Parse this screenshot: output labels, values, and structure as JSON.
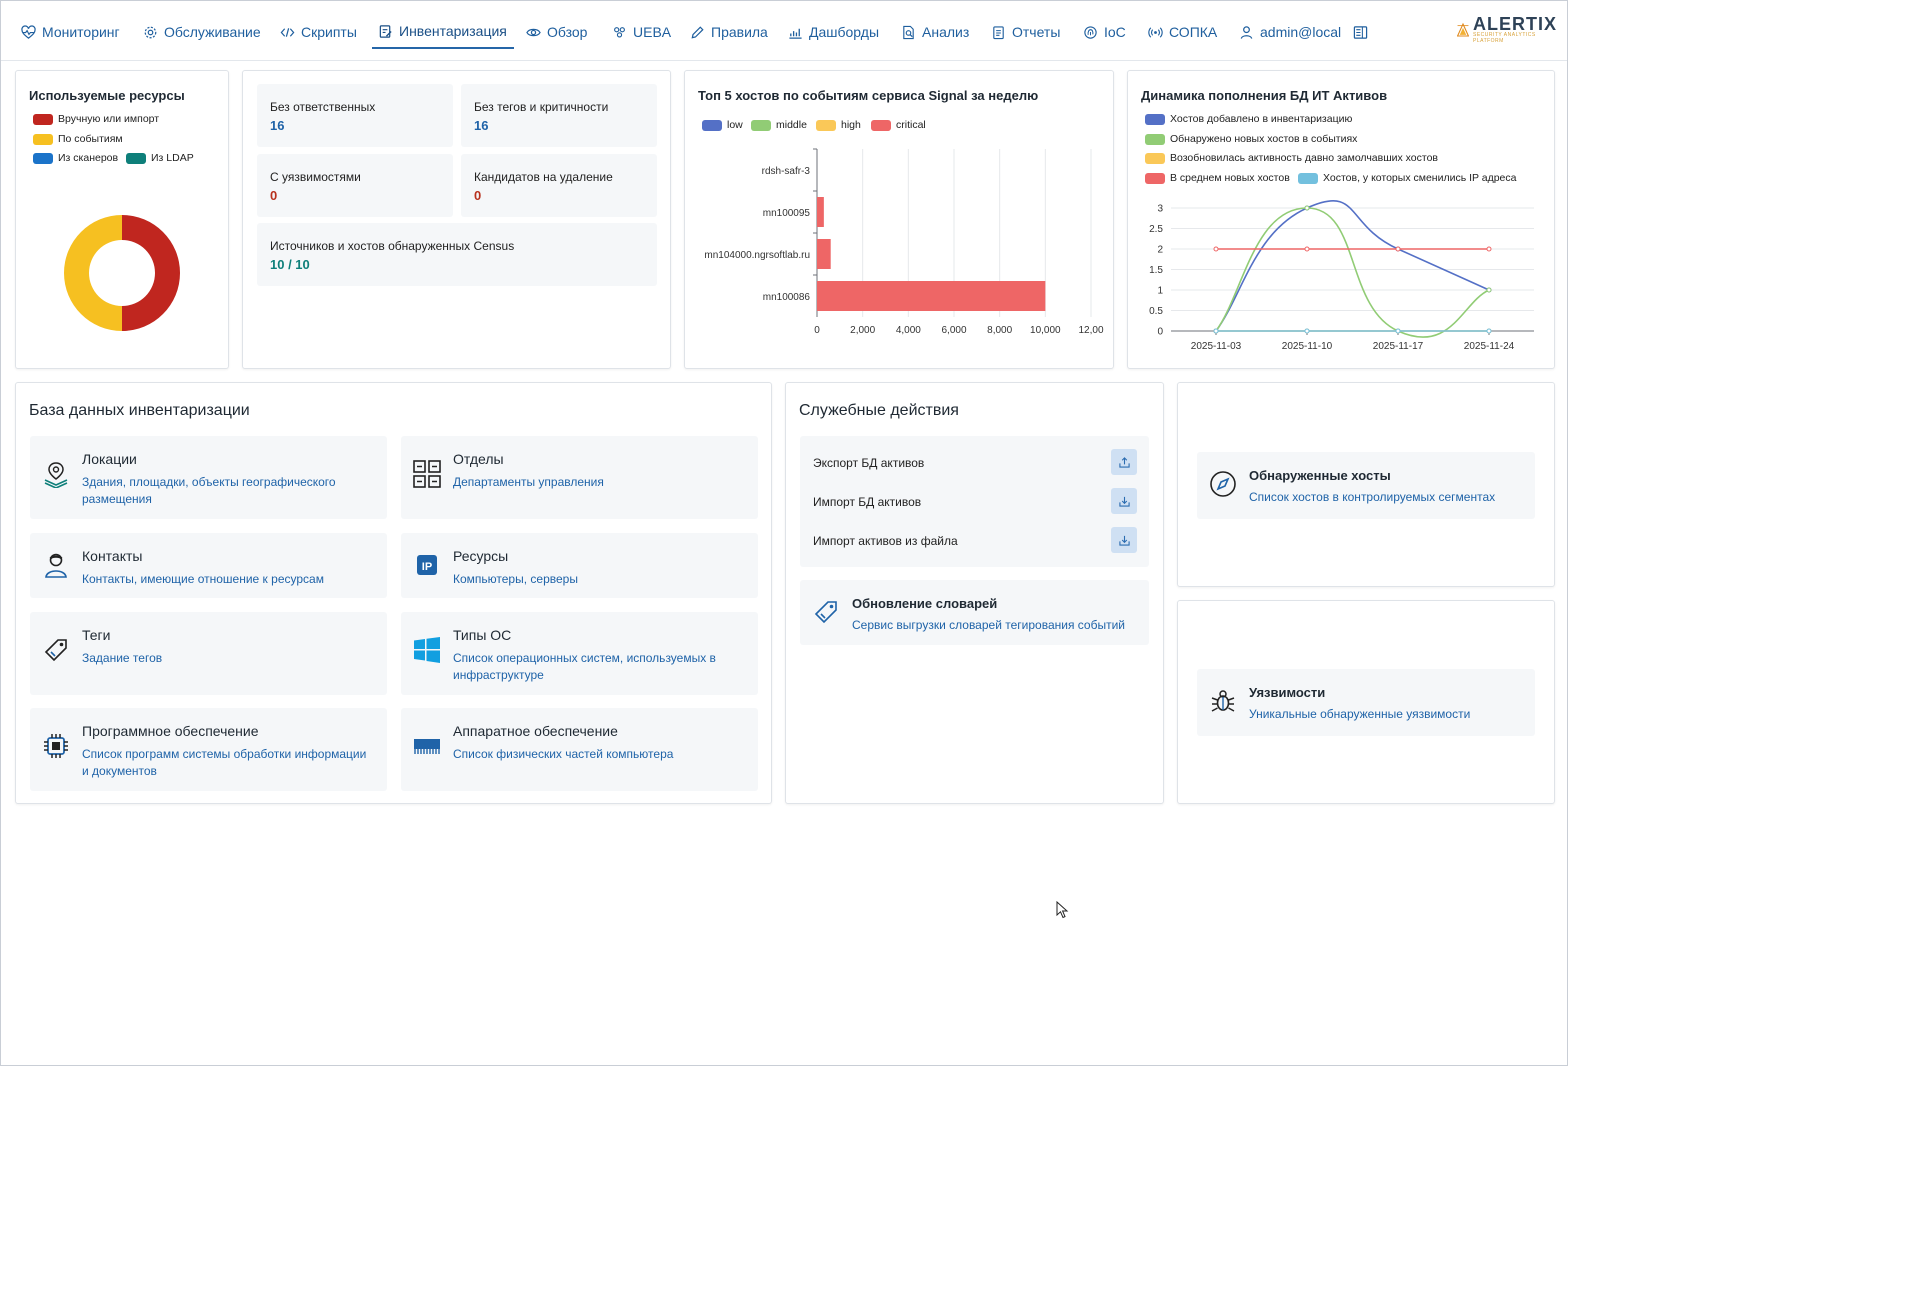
{
  "nav": {
    "items": [
      {
        "label": "Мониторинг",
        "icon": "heart-pulse-icon"
      },
      {
        "label": "Обслуживание",
        "icon": "gear-icon"
      },
      {
        "label": "Скрипты",
        "icon": "code-icon"
      },
      {
        "label": "Инвентаризация",
        "icon": "clipboard-edit-icon",
        "active": true
      },
      {
        "label": "Обзор",
        "icon": "eye-icon"
      },
      {
        "label": "UEBA",
        "icon": "users-icon"
      },
      {
        "label": "Правила",
        "icon": "pencil-icon"
      },
      {
        "label": "Дашборды",
        "icon": "chart-icon"
      },
      {
        "label": "Анализ",
        "icon": "search-doc-icon"
      },
      {
        "label": "Отчеты",
        "icon": "report-icon"
      },
      {
        "label": "IoC",
        "icon": "fingerprint-icon"
      },
      {
        "label": "СОПКА",
        "icon": "broadcast-icon"
      },
      {
        "label": "admin@local",
        "icon": "user-icon"
      }
    ],
    "panel_toggle_icon": "sidebar-toggle-icon",
    "logo_text": "ALERTIX",
    "logo_sub": "SECURITY ANALYTICS PLATFORM"
  },
  "resources": {
    "title": "Используемые ресурсы",
    "legend": [
      {
        "label": "Вручную или импорт",
        "color": "#c0261f"
      },
      {
        "label": "По событиям",
        "color": "#f6c021"
      },
      {
        "label": "Из сканеров",
        "color": "#1b73c9"
      },
      {
        "label": "Из LDAP",
        "color": "#0e7f7a"
      }
    ]
  },
  "stats": {
    "no_owner_label": "Без ответственных",
    "no_owner_value": "16",
    "no_tags_label": "Без тегов и критичности",
    "no_tags_value": "16",
    "vuln_label": "С уязвимостями",
    "vuln_value": "0",
    "delete_label": "Кандидатов на удаление",
    "delete_value": "0",
    "census_label": "Источников и хостов обнаруженных Census",
    "census_value": "10 / 10"
  },
  "top_hosts": {
    "title": "Топ 5 хостов по событиям сервиса Signal за неделю",
    "legend": [
      {
        "label": "low",
        "color": "#5470c6"
      },
      {
        "label": "middle",
        "color": "#91cc75"
      },
      {
        "label": "high",
        "color": "#fac858"
      },
      {
        "label": "critical",
        "color": "#ee6666"
      }
    ]
  },
  "growth": {
    "title": "Динамика пополнения БД ИТ Активов",
    "legend": [
      {
        "label": "Хостов добавлено в инвентаризацию",
        "color": "#5470c6"
      },
      {
        "label": "Обнаружено новых хостов в событиях",
        "color": "#91cc75"
      },
      {
        "label": "Возобновилась активность давно замолчавших хостов",
        "color": "#fac858"
      },
      {
        "label": "В среднем новых хостов",
        "color": "#ee6666"
      },
      {
        "label": "Хостов, у которых сменились IP адреса",
        "color": "#73c0de"
      }
    ]
  },
  "chart_data": [
    {
      "type": "pie",
      "categories": [
        "Вручную или импорт",
        "По событиям",
        "Из сканеров",
        "Из LDAP"
      ],
      "values": [
        50,
        50,
        0,
        0
      ],
      "colors": [
        "#c0261f",
        "#f6c021",
        "#1b73c9",
        "#0e7f7a"
      ],
      "donut": true
    },
    {
      "type": "bar",
      "orientation": "horizontal",
      "title": "Топ 5 хостов по событиям сервиса Signal за неделю",
      "categories": [
        "rdsh-safr-3",
        "mn100095",
        "mn104000.ngrsoftlab.ru",
        "mn100086"
      ],
      "series": [
        {
          "name": "critical",
          "values": [
            0,
            300,
            600,
            10000
          ]
        }
      ],
      "xlim": [
        0,
        12000
      ],
      "x_ticks": [
        "0",
        "2,000",
        "4,000",
        "6,000",
        "8,000",
        "10,000",
        "12,00"
      ]
    },
    {
      "type": "line",
      "title": "Динамика пополнения БД ИТ Активов",
      "x": [
        "2025-11-03",
        "2025-11-10",
        "2025-11-17",
        "2025-11-24"
      ],
      "series": [
        {
          "name": "Хостов добавлено в инвентаризацию",
          "values": [
            0,
            3,
            2,
            1
          ],
          "smooth": true
        },
        {
          "name": "Обнаружено новых хостов в событиях",
          "values": [
            0,
            3,
            0,
            1
          ],
          "smooth": true
        },
        {
          "name": "Возобновилась активность давно замолчавших хостов",
          "values": [
            0,
            0,
            0,
            0
          ]
        },
        {
          "name": "В среднем новых хостов",
          "values": [
            2,
            2,
            2,
            2
          ]
        },
        {
          "name": "Хостов, у которых сменились IP адреса",
          "values": [
            0,
            0,
            0,
            0
          ]
        }
      ],
      "ylim": [
        0,
        3
      ],
      "y_ticks": [
        "0",
        "0.5",
        "1",
        "1.5",
        "2",
        "2.5",
        "3"
      ]
    }
  ],
  "inventory_db": {
    "title": "База данных инвентаризации",
    "tiles": [
      {
        "title": "Локации",
        "desc": "Здания, площадки, объекты географического размещения",
        "icon": "location-pin-icon"
      },
      {
        "title": "Отделы",
        "desc": "Департаменты управления",
        "icon": "departments-grid-icon"
      },
      {
        "title": "Контакты",
        "desc": "Контакты, имеющие отношение к ресурсам",
        "icon": "contact-person-icon"
      },
      {
        "title": "Ресурсы",
        "desc": "Компьютеры, серверы",
        "icon": "ip-icon"
      },
      {
        "title": "Теги",
        "desc": "Задание тегов",
        "icon": "tag-icon"
      },
      {
        "title": "Типы ОС",
        "desc": "Список операционных систем, используемых в инфраструктуре",
        "icon": "windows-icon"
      },
      {
        "title": "Программное обеспечение",
        "desc": "Список программ системы обработки информации и документов",
        "icon": "chip-icon"
      },
      {
        "title": "Аппаратное обеспечение",
        "desc": "Список физических частей компьютера",
        "icon": "memory-module-icon"
      }
    ]
  },
  "service": {
    "title": "Служебные действия",
    "actions": [
      {
        "label": "Экспорт БД активов",
        "icon": "upload-icon"
      },
      {
        "label": "Импорт БД активов",
        "icon": "download-icon"
      },
      {
        "label": "Импорт активов из файла",
        "icon": "download-icon"
      }
    ],
    "dict_title": "Обновление словарей",
    "dict_desc": "Сервис выгрузки словарей тегирования событий",
    "dict_icon": "tag-icon"
  },
  "discovered": {
    "title": "Обнаруженные хосты",
    "desc": "Список хостов в контролируемых сегментах",
    "icon": "compass-icon"
  },
  "vulns": {
    "title": "Уязвимости",
    "desc": "Уникальные обнаруженные уязвимости",
    "icon": "bug-icon"
  }
}
